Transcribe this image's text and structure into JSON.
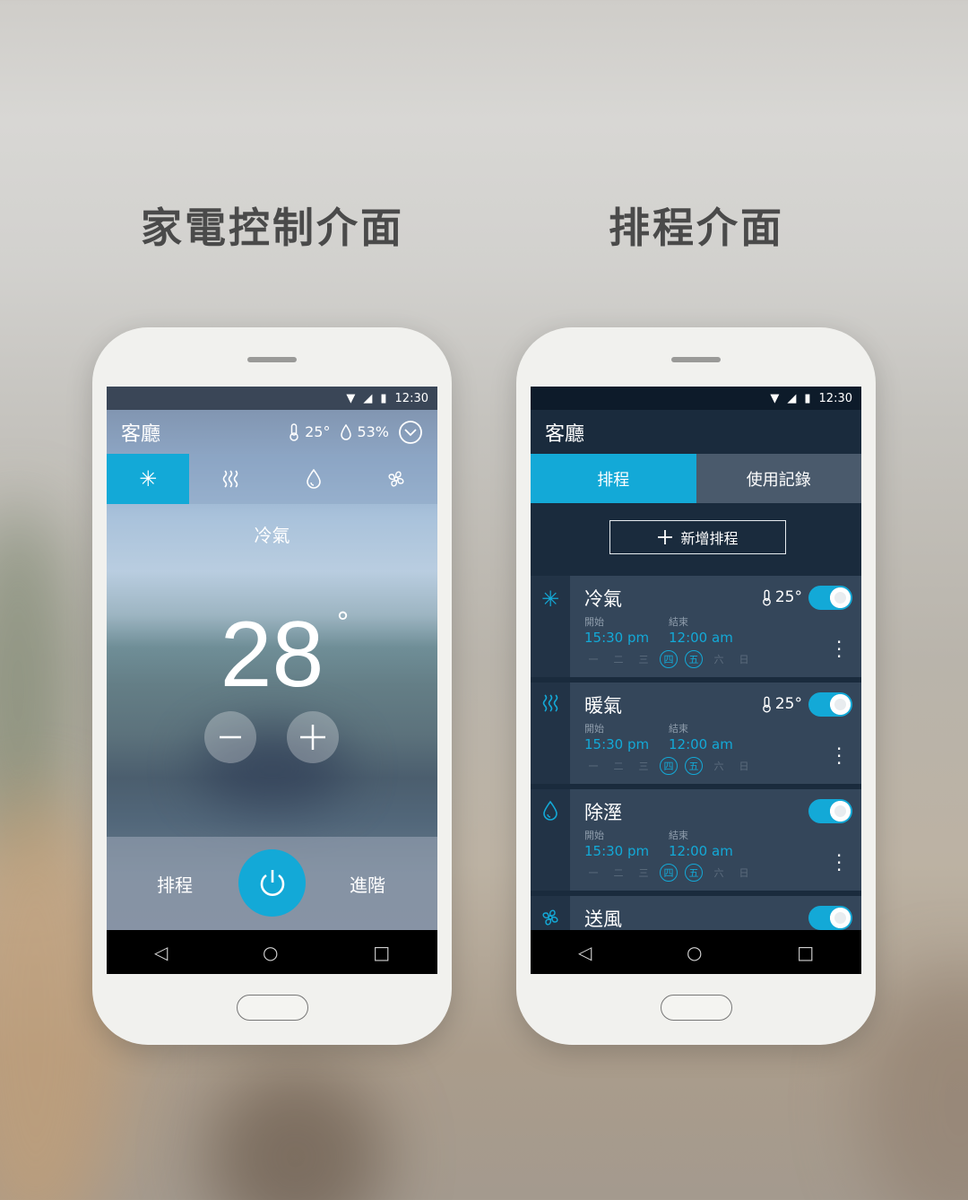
{
  "captions": {
    "left": "家電控制介面",
    "right": "排程介面"
  },
  "colors": {
    "accent": "#13a9d7",
    "dark_bg": "#1a2b3d",
    "card_bg": "#34465a"
  },
  "status": {
    "time": "12:30",
    "icons": [
      "wifi-icon",
      "signal-icon",
      "battery-icon"
    ]
  },
  "control": {
    "room": "客廳",
    "indoor_temp": "25°",
    "humidity": "53%",
    "modes": [
      {
        "icon": "snowflake-icon",
        "name": "cool",
        "active": true
      },
      {
        "icon": "heat-waves-icon",
        "name": "heat",
        "active": false
      },
      {
        "icon": "droplet-icon",
        "name": "dry",
        "active": false
      },
      {
        "icon": "fan-icon",
        "name": "fan",
        "active": false
      }
    ],
    "mode_label": "冷氣",
    "set_temp": "28",
    "degree": "°",
    "schedule_label": "排程",
    "advanced_label": "進階"
  },
  "schedule": {
    "room": "客廳",
    "tabs": [
      {
        "label": "排程",
        "active": true
      },
      {
        "label": "使用記錄",
        "active": false
      }
    ],
    "add_label": "新增排程",
    "start_label": "開始",
    "end_label": "結束",
    "weekdays": [
      "一",
      "二",
      "三",
      "四",
      "五",
      "六",
      "日"
    ],
    "items": [
      {
        "icon": "snowflake-icon",
        "name": "冷氣",
        "temp": "25°",
        "start": "15:30 pm",
        "end": "12:00 am",
        "active_days": [
          "四",
          "五"
        ],
        "enabled": true
      },
      {
        "icon": "heat-waves-icon",
        "name": "暖氣",
        "temp": "25°",
        "start": "15:30 pm",
        "end": "12:00 am",
        "active_days": [
          "四",
          "五"
        ],
        "enabled": true
      },
      {
        "icon": "droplet-icon",
        "name": "除溼",
        "temp": "",
        "start": "15:30 pm",
        "end": "12:00 am",
        "active_days": [
          "四",
          "五"
        ],
        "enabled": true
      },
      {
        "icon": "fan-icon",
        "name": "送風",
        "temp": "",
        "start": "",
        "end": "",
        "active_days": [],
        "enabled": true
      }
    ]
  },
  "nav": {
    "back": "◁",
    "home": "○",
    "recents": "□"
  }
}
